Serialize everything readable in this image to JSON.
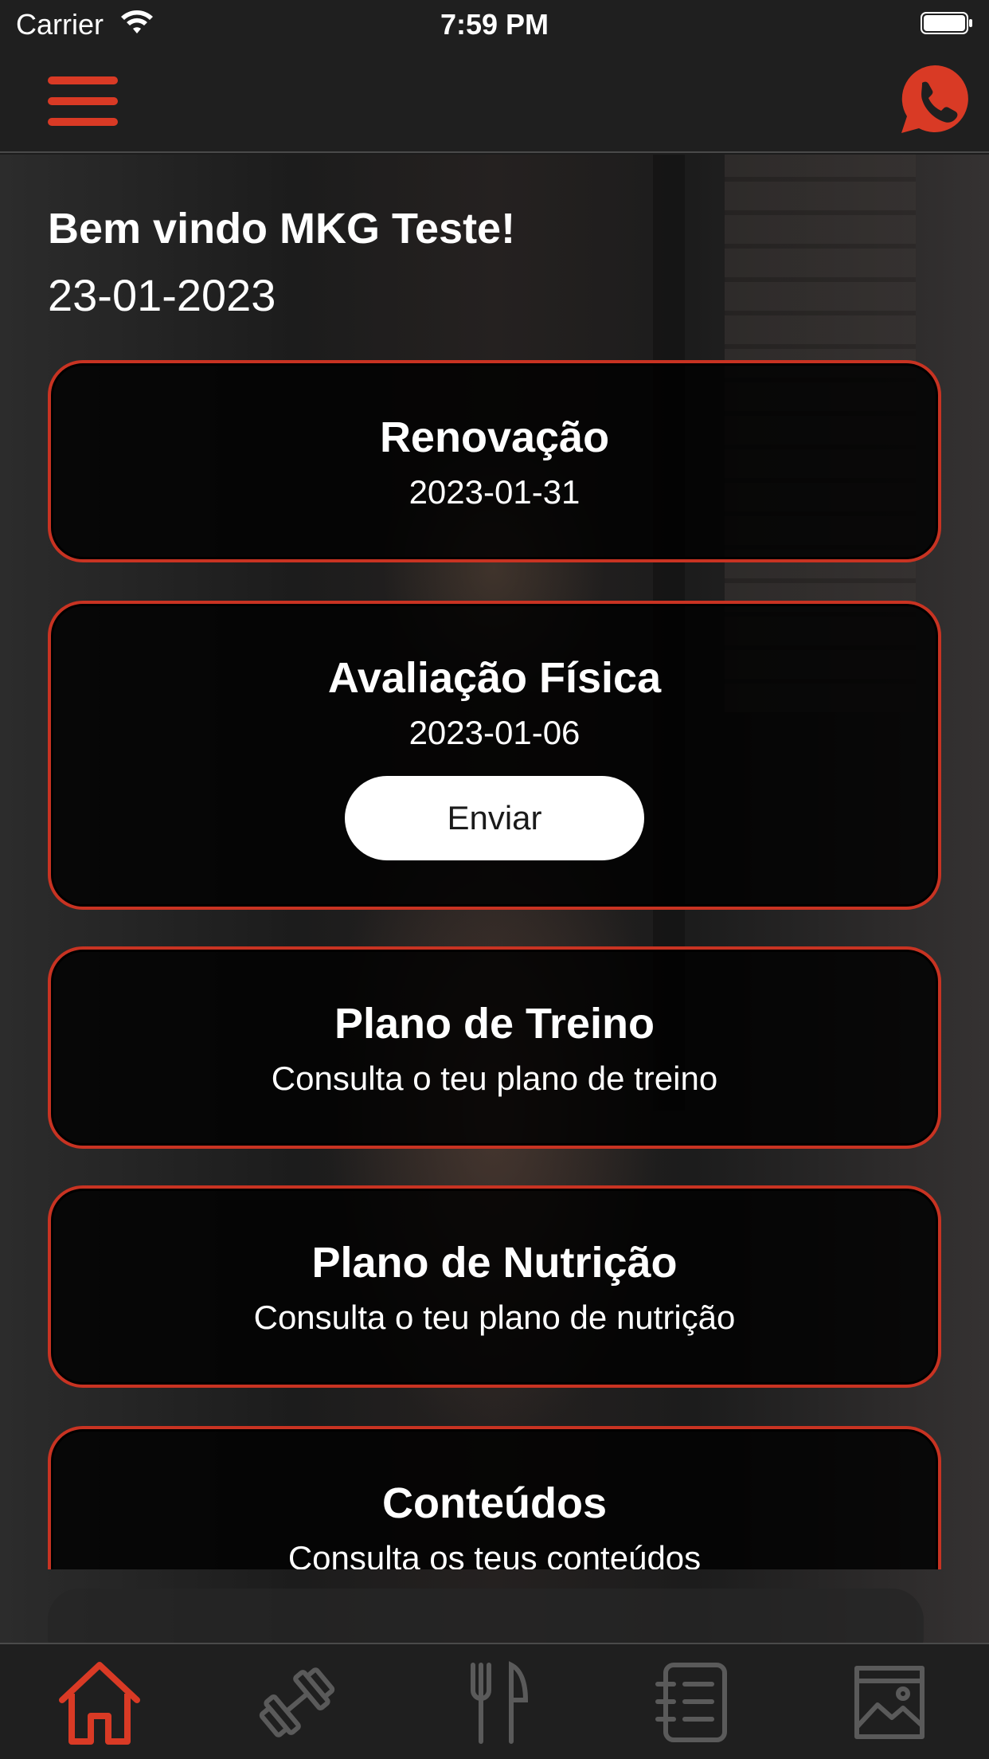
{
  "status_bar": {
    "carrier": "Carrier",
    "time": "7:59 PM"
  },
  "header": {
    "menu_icon": "hamburger-menu-icon",
    "contact_icon": "whatsapp-icon"
  },
  "welcome": {
    "greeting": "Bem vindo MKG Teste!",
    "date": "23-01-2023"
  },
  "cards": [
    {
      "title": "Renovação",
      "subtitle": "2023-01-31"
    },
    {
      "title": "Avaliação Física",
      "subtitle": "2023-01-06",
      "button": "Enviar"
    },
    {
      "title": "Plano de Treino",
      "subtitle": "Consulta o teu plano de treino"
    },
    {
      "title": "Plano de Nutrição",
      "subtitle": "Consulta o teu plano de nutrição"
    },
    {
      "title": "Conteúdos",
      "subtitle": "Consulta os teus conteúdos"
    }
  ],
  "tabs": [
    {
      "icon": "home-icon",
      "active": true
    },
    {
      "icon": "dumbbell-icon",
      "active": false
    },
    {
      "icon": "fork-knife-icon",
      "active": false
    },
    {
      "icon": "notes-list-icon",
      "active": false
    },
    {
      "icon": "gallery-image-icon",
      "active": false
    }
  ],
  "colors": {
    "accent": "#d93a25",
    "card_border": "#c83322",
    "inactive_icon": "#5a5a5a",
    "bar_bg": "#1f1f1f"
  }
}
